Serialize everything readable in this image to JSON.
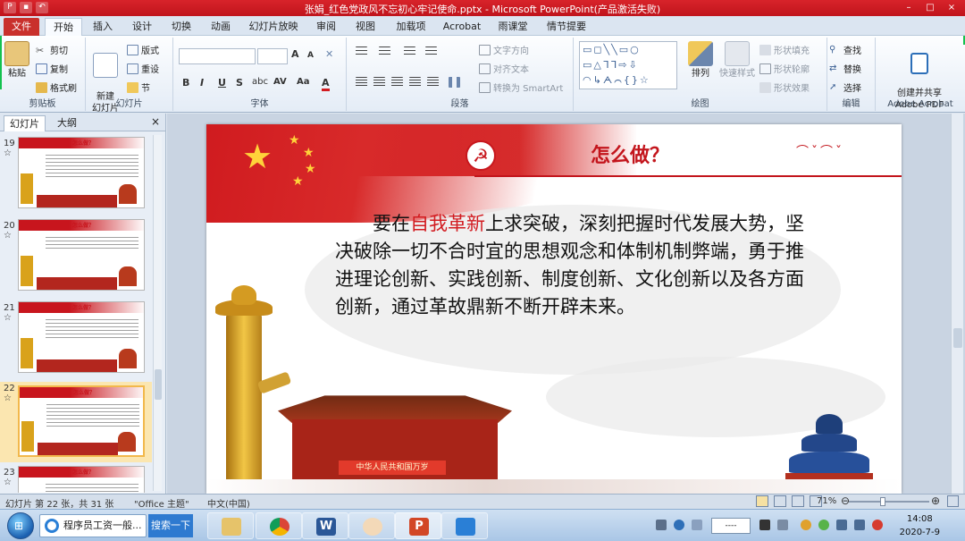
{
  "window": {
    "title": "张娟_红色党政风不忘初心牢记使命.pptx - Microsoft PowerPoint(产品激活失败)"
  },
  "ribbon_tabs": [
    "文件",
    "开始",
    "插入",
    "设计",
    "切换",
    "动画",
    "幻灯片放映",
    "审阅",
    "视图",
    "加载项",
    "Acrobat",
    "雨课堂",
    "情节提要"
  ],
  "ribbon": {
    "clipboard": {
      "label": "剪贴板",
      "paste": "粘贴",
      "cut": "剪切",
      "copy": "复制",
      "format_painter": "格式刷"
    },
    "slides": {
      "label": "幻灯片",
      "new_slide": "新建\n幻灯片",
      "layout": "版式",
      "reset": "重设",
      "section": "节"
    },
    "font": {
      "label": "字体",
      "bold": "B",
      "italic": "I",
      "underline": "U",
      "strike": "S",
      "shadow": "abc",
      "spacing": "AV",
      "case": "Aa",
      "grow": "A",
      "shrink": "A",
      "color": "A"
    },
    "paragraph": {
      "label": "段落",
      "text_direction": "文字方向",
      "align_text": "对齐文本",
      "smartart": "转换为 SmartArt"
    },
    "drawing": {
      "label": "绘图",
      "arrange": "排列",
      "quick_styles": "快速样式",
      "shape_fill": "形状填充",
      "shape_outline": "形状轮廓",
      "shape_effects": "形状效果"
    },
    "editing": {
      "label": "编辑",
      "find": "查找",
      "replace": "替换",
      "select": "选择"
    },
    "acrobat": {
      "label": "Adobe Acrobat",
      "create_share": "创建并共享\nAdobe PDF"
    }
  },
  "left_pane": {
    "tabs": [
      "幻灯片",
      "大纲"
    ],
    "close": "×",
    "thumbnails": [
      {
        "num": "19",
        "title": "怎么做？",
        "selected": false
      },
      {
        "num": "20",
        "title": "怎么做？",
        "selected": false
      },
      {
        "num": "21",
        "title": "怎么做？",
        "selected": false
      },
      {
        "num": "22",
        "title": "怎么做？",
        "selected": true
      },
      {
        "num": "23",
        "title": "怎么做？",
        "selected": false
      }
    ]
  },
  "slide": {
    "title": "怎么做？",
    "body_before": "要在",
    "body_highlight": "自我革新",
    "body_after": "上求突破，深刻把握时代发展大势，坚决破除一切不合时宜的思想观念和体制机制弊端，勇于推进理论创新、实践创新、制度创新、文化创新以及各方面创新，通过革故鼎新不断开辟未来。",
    "gate_sign": "中华人民共和国万岁"
  },
  "status_bar": {
    "slide_info": "幻灯片 第 22 张，共 31 张",
    "theme": "\"Office 主题\"",
    "language": "中文(中国)",
    "zoom": "71%",
    "zoom_fraction": 0.71
  },
  "taskbar": {
    "search_text": "程序员工资一般...",
    "search_button": "搜索一下",
    "tray_dash": "----",
    "time": "14:08",
    "date": "2020-7-9"
  },
  "colors": {
    "accent_red": "#c3151c",
    "title_bar": "#c0141c",
    "highlight": "#d21b20"
  }
}
